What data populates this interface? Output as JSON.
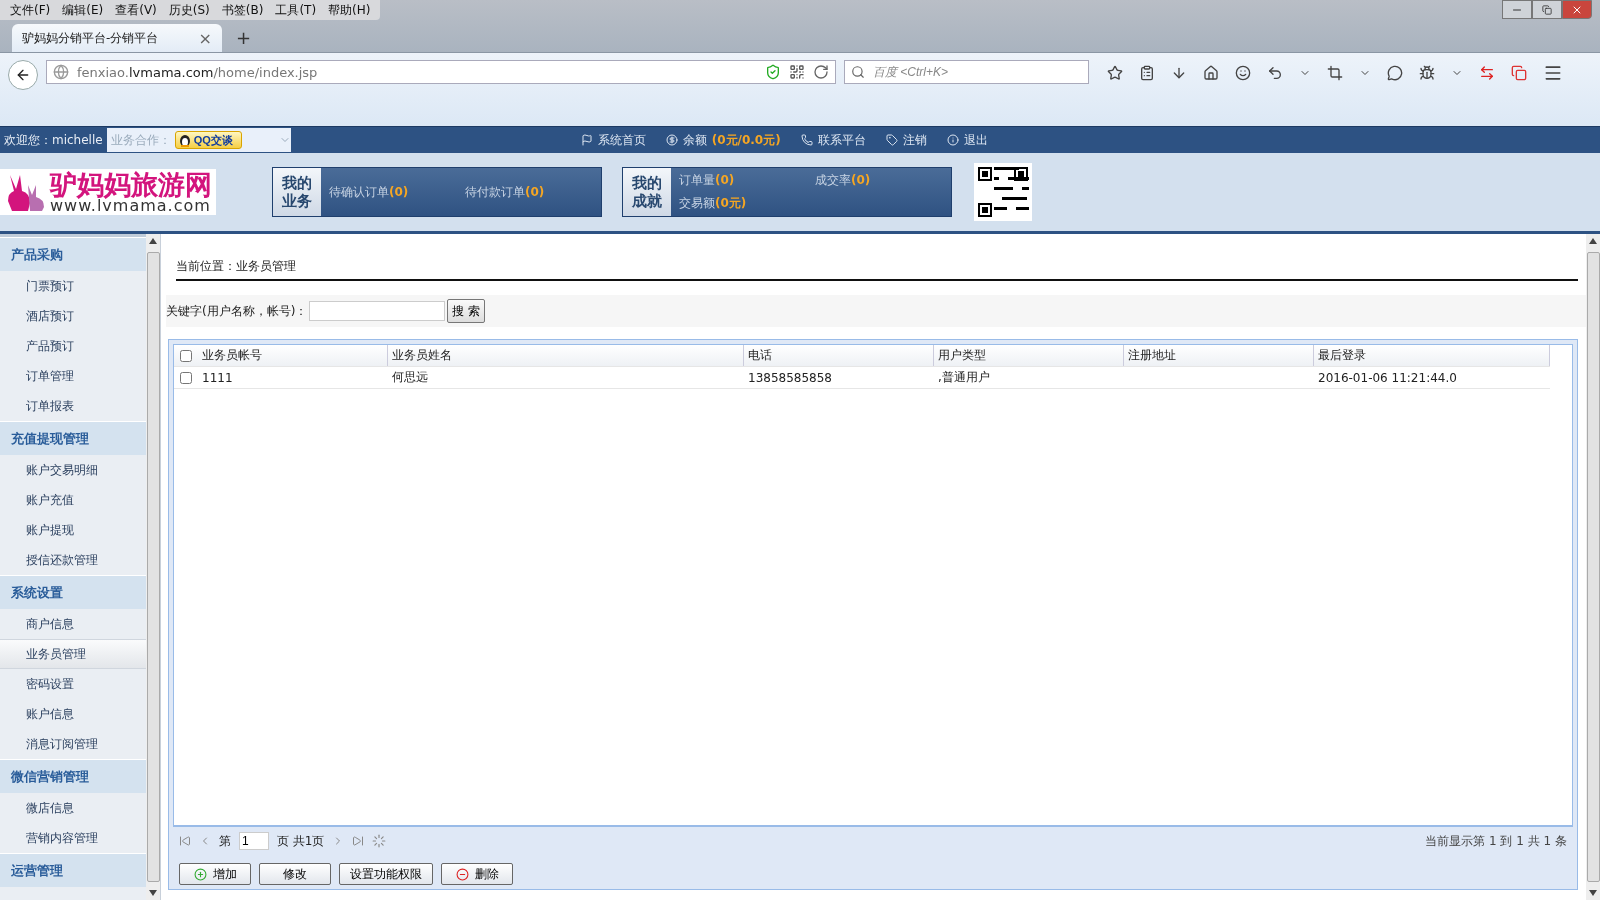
{
  "browser": {
    "menu": [
      "文件(F)",
      "编辑(E)",
      "查看(V)",
      "历史(S)",
      "书签(B)",
      "工具(T)",
      "帮助(H)"
    ],
    "tab": {
      "title": "驴妈妈分销平台-分销平台",
      "close": "×",
      "new": "+"
    },
    "url": "fenxiao.**lvmama.com**/home/index.jsp",
    "search_placeholder": "百度 <Ctrl+K>"
  },
  "topbar": {
    "welcome": "欢迎您：michelle",
    "coop_label": "业务合作：",
    "qq_button": "QQ交谈",
    "links": [
      {
        "kind": "flag",
        "label": "系统首页"
      },
      {
        "kind": "coin",
        "label": "余额",
        "value": "(0元/0.0元)"
      },
      {
        "kind": "phone",
        "label": "联系平台"
      },
      {
        "kind": "tag",
        "label": "注销"
      },
      {
        "kind": "info",
        "label": "退出"
      }
    ]
  },
  "header": {
    "logo": "驴妈妈旅游网",
    "logo_url": "www.lvmama.com",
    "panels": [
      {
        "title": [
          "我的",
          "业务"
        ],
        "stats": [
          {
            "label": "待确认订单",
            "value": "(0)"
          },
          {
            "label": "待付款订单",
            "value": "(0)"
          }
        ]
      },
      {
        "title": [
          "我的",
          "成就"
        ],
        "stats": [
          {
            "label": "订单量",
            "value": "(0)"
          },
          {
            "label": "成交率",
            "value": "(0)"
          },
          {
            "label": "交易额",
            "value": "(0元)"
          }
        ]
      }
    ]
  },
  "sidebar": [
    {
      "title": "产品采购",
      "items": [
        {
          "label": "门票预订",
          "selected": false
        },
        {
          "label": "酒店预订",
          "selected": false
        },
        {
          "label": "产品预订",
          "selected": false
        },
        {
          "label": "订单管理",
          "selected": false
        },
        {
          "label": "订单报表",
          "selected": false
        }
      ]
    },
    {
      "title": "充值提现管理",
      "items": [
        {
          "label": "账户交易明细",
          "selected": false
        },
        {
          "label": "账户充值",
          "selected": false
        },
        {
          "label": "账户提现",
          "selected": false
        },
        {
          "label": "授信还款管理",
          "selected": false
        }
      ]
    },
    {
      "title": "系统设置",
      "items": [
        {
          "label": "商户信息",
          "selected": false
        },
        {
          "label": "业务员管理",
          "selected": true
        },
        {
          "label": "密码设置",
          "selected": false
        },
        {
          "label": "账户信息",
          "selected": false
        },
        {
          "label": "消息订阅管理",
          "selected": false
        }
      ]
    },
    {
      "title": "微信营销管理",
      "items": [
        {
          "label": "微店信息",
          "selected": false
        },
        {
          "label": "营销内容管理",
          "selected": false
        }
      ]
    },
    {
      "title": "运营管理"
    }
  ],
  "content": {
    "breadcrumb": "当前位置：业务员管理",
    "search_label": "关键字(用户名称，帐号)：",
    "search_button": "搜 索",
    "table": {
      "header_checked": false,
      "columns": [
        "业务员帐号",
        "业务员姓名",
        "电话",
        "用户类型",
        "注册地址",
        "最后登录"
      ],
      "rows": [
        {
          "checked": false,
          "cells": [
            "1111",
            "何思远",
            "13858585858",
            ",普通用户",
            "",
            "2016-01-06 11:21:44.0"
          ]
        }
      ]
    },
    "pager": {
      "prefix": "第",
      "page": "1",
      "suffix": "页 共1页",
      "info": "当前显示第 1 到 1 共 1 条"
    },
    "buttons": [
      {
        "kind": "add",
        "label": "增加"
      },
      {
        "kind": "plain",
        "label": "修改"
      },
      {
        "kind": "plain",
        "label": "设置功能权限"
      },
      {
        "kind": "delete",
        "label": "删除"
      }
    ]
  }
}
